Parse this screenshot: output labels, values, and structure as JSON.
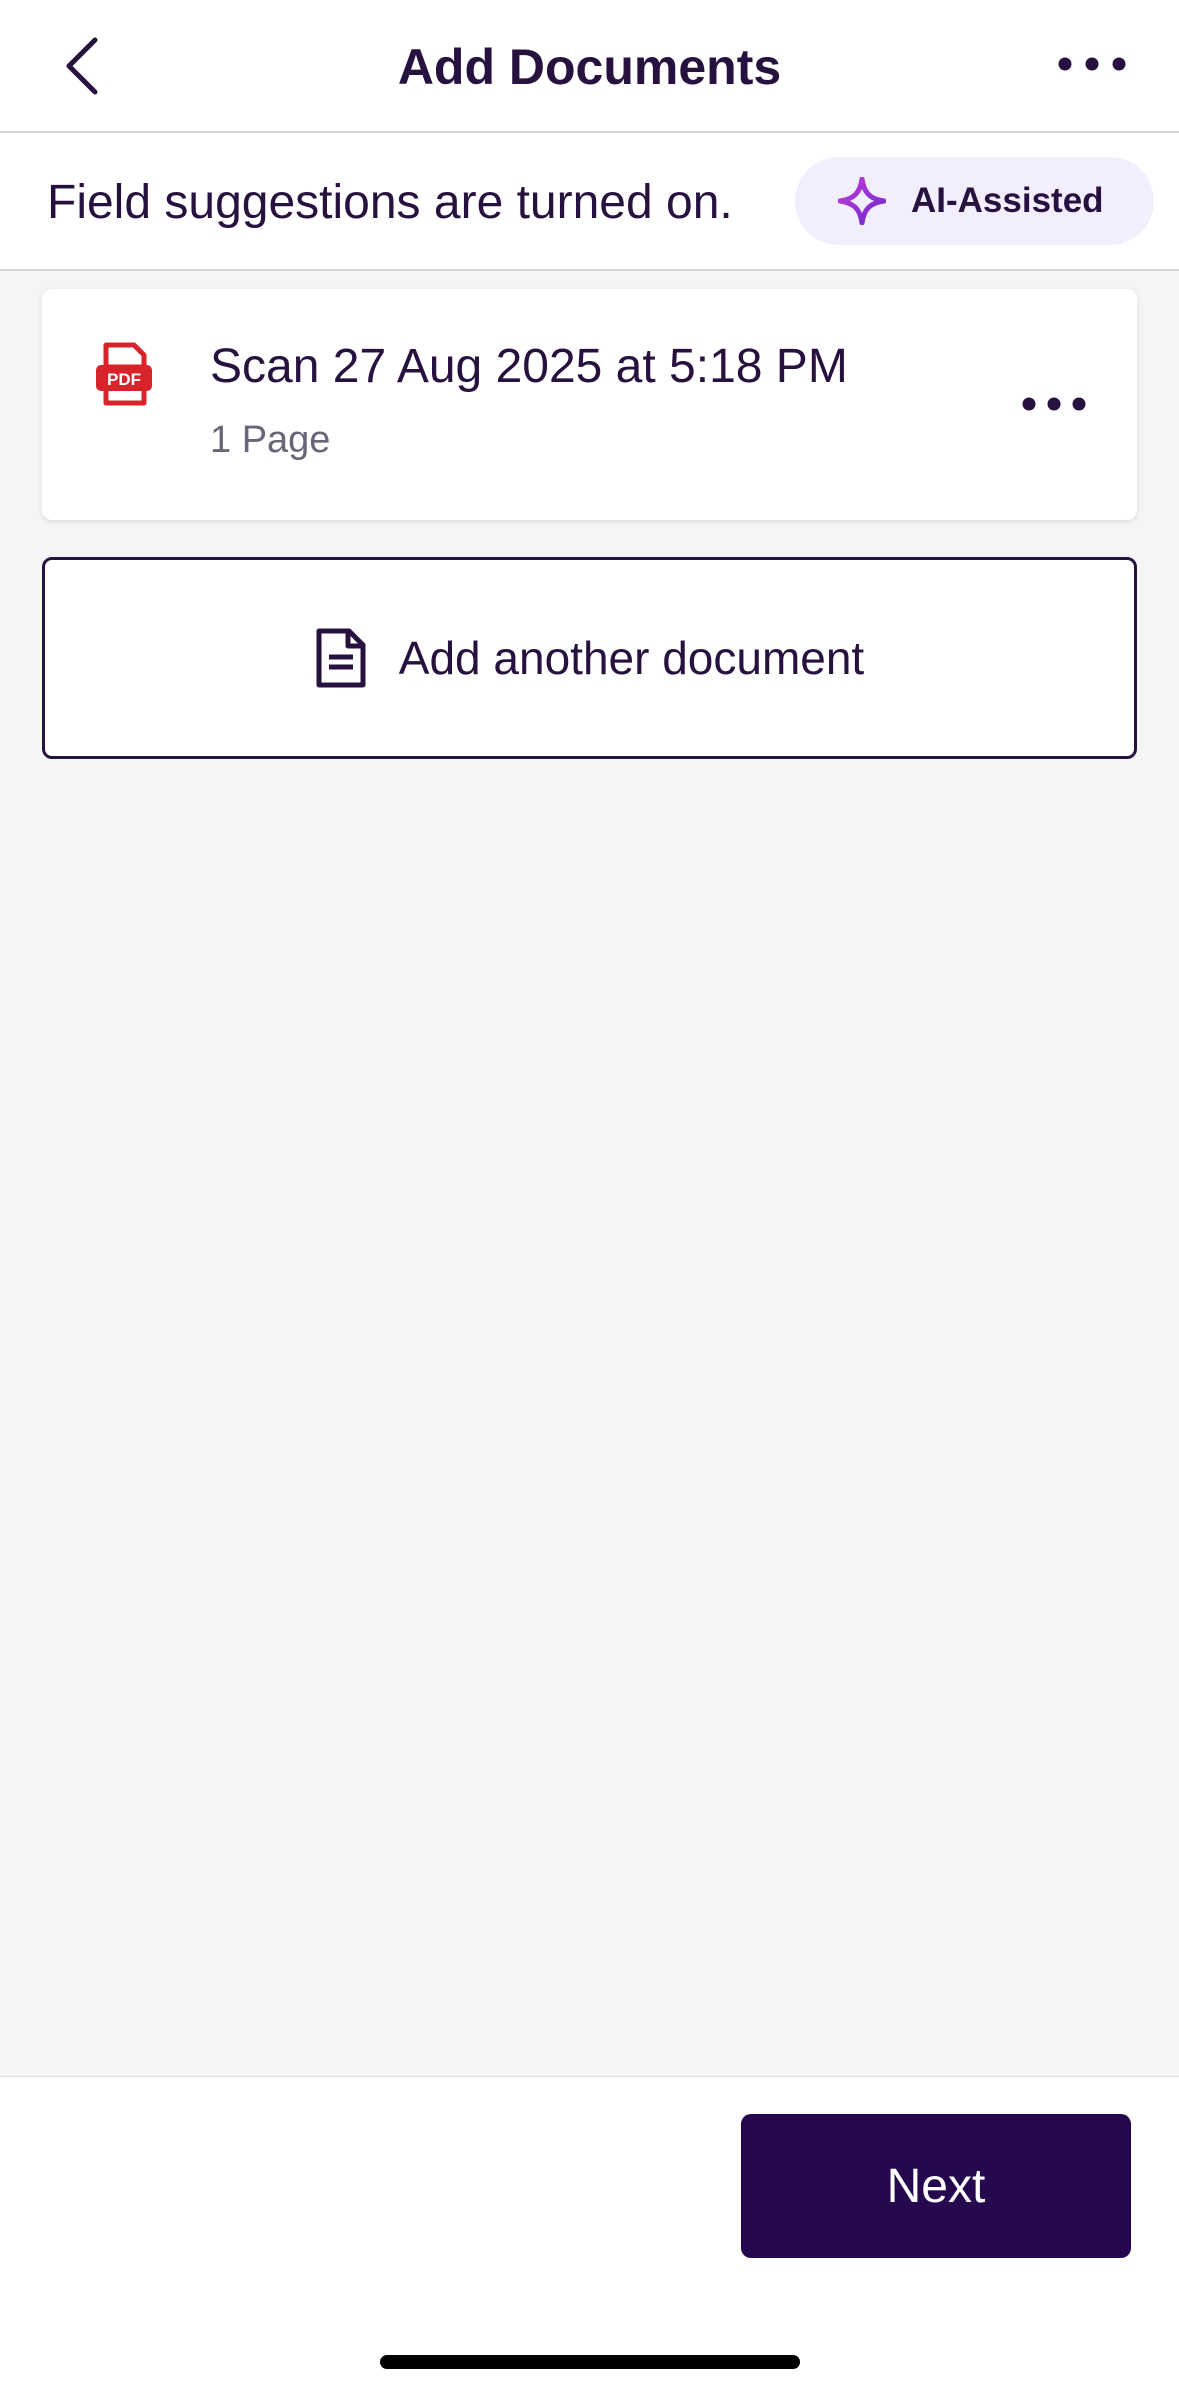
{
  "header": {
    "title": "Add Documents",
    "back_icon": "chevron-left-icon",
    "more_icon": "more-horizontal-icon"
  },
  "suggestions": {
    "text": "Field suggestions are turned on.",
    "chip_label": "AI-Assisted",
    "chip_icon": "sparkle-icon"
  },
  "documents": [
    {
      "name": "Scan 27 Aug 2025 at 5:18 PM",
      "pages": "1 Page",
      "type_icon": "pdf-icon",
      "more_icon": "more-horizontal-icon"
    }
  ],
  "add_document": {
    "label": "Add another document",
    "icon": "document-icon"
  },
  "footer": {
    "next_label": "Next"
  },
  "colors": {
    "primary": "#26084f",
    "text": "#26113f",
    "muted": "#6b6478",
    "pdf_red": "#d8232a",
    "chip_bg": "#f2eefc",
    "background": "#f5f5f6"
  }
}
